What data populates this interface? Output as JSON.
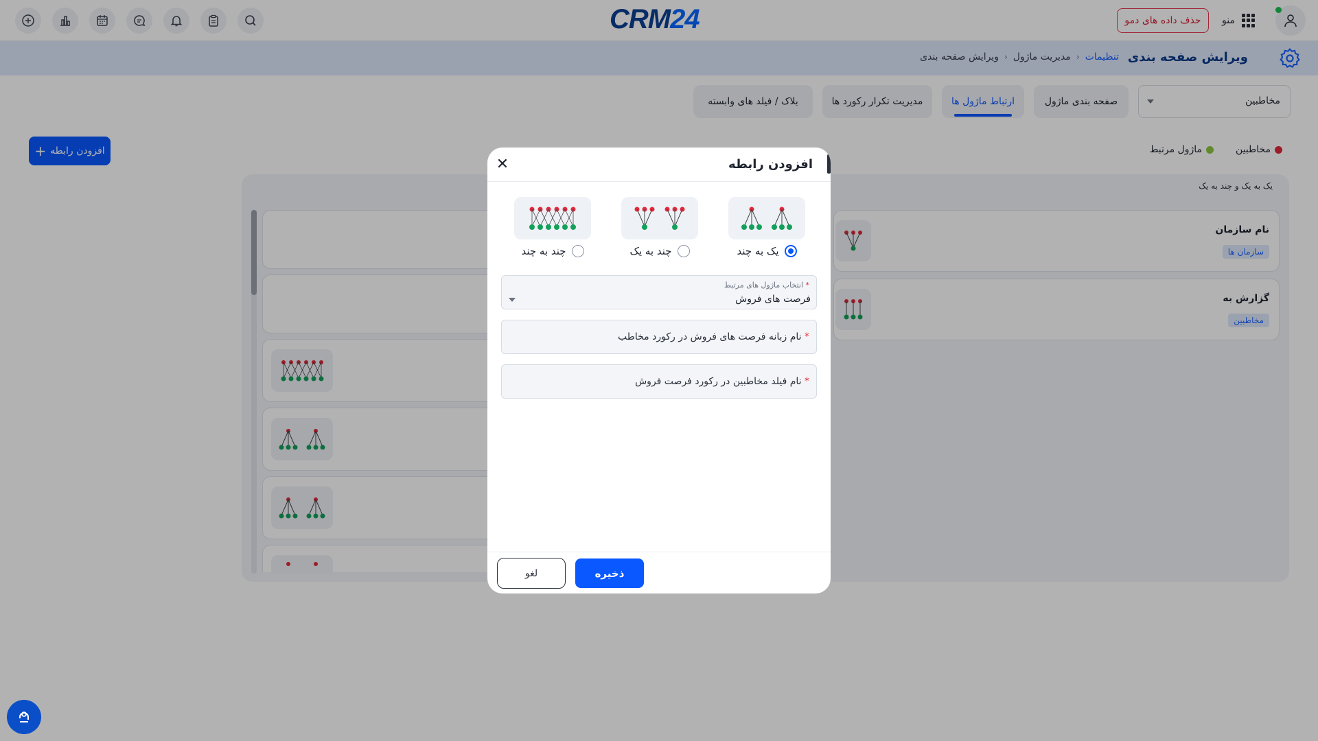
{
  "topbar": {
    "logo_main": "CRM",
    "logo_num": "24",
    "demo_button": "حذف داده های دمو",
    "menu_label": "منو",
    "icons": [
      "add-icon",
      "chart-icon",
      "calendar-icon",
      "chat-icon",
      "bell-icon",
      "clipboard-icon",
      "search-icon"
    ]
  },
  "header": {
    "title": "ویرایش صفحه بندی",
    "breadcrumb": [
      "تنظیمات",
      "مدیریت ماژول",
      "ویرایش صفحه بندی"
    ]
  },
  "module_select": {
    "value": "مخاطبین"
  },
  "tabs": [
    {
      "label": "صفحه بندی ماژول"
    },
    {
      "label": "ارتباط ماژول ها",
      "active": true
    },
    {
      "label": "مدیریت تکرار رکورد ها"
    },
    {
      "label": "بلاک / فیلد های وابسته"
    }
  ],
  "legend": [
    {
      "label": "مخاطبین",
      "color": "#e02a3c"
    },
    {
      "label": "ماژول مرتبط",
      "color": "#8cc63f"
    }
  ],
  "add_relation_button": "افزودن رابطه",
  "panel": {
    "caption": "یک به یک و چند به یک",
    "cards": [
      {
        "name": "نام سازمان",
        "tag": "سازمان ها"
      },
      {
        "name": "گزارش به",
        "tag": "مخاطبین"
      }
    ]
  },
  "modal": {
    "title": "افزودن رابطه",
    "options": [
      {
        "label": "یک به چند",
        "selected": true
      },
      {
        "label": "چند به یک",
        "selected": false
      },
      {
        "label": "چند به چند",
        "selected": false
      }
    ],
    "related_module": {
      "label": "انتخاب ماژول های مرتبط",
      "value": "فرصت های فروش"
    },
    "tab_name_field": {
      "placeholder": "نام زبانه فرصت های فروش در رکورد مخاطب"
    },
    "field_name_field": {
      "placeholder": "نام فیلد مخاطبین در رکورد فرصت فروش"
    },
    "save_button": "ذخیره",
    "cancel_button": "لغو"
  },
  "colors": {
    "primary": "#0a58ff",
    "red_node": "#e02a3c",
    "green_node": "#13a05a"
  }
}
